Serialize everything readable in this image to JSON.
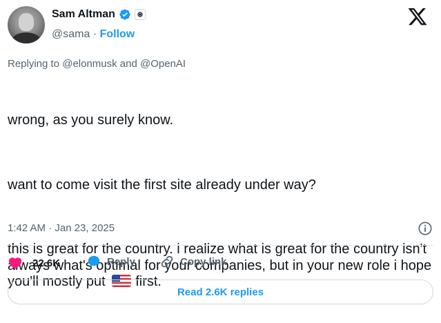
{
  "author": {
    "name": "Sam Altman",
    "handle": "@sama",
    "separator": " · ",
    "follow_label": "Follow",
    "verified_color": "#1d9bf0"
  },
  "reply_context": "Replying to @elonmusk and @OpenAI",
  "tweet": {
    "paragraph_1": "wrong, as you surely know.",
    "paragraph_2": "want to come visit the first site already under way?",
    "paragraph_3_before_flag": "this is great for the country. i realize what is great for the country isn't always what's optimal for your companies, but in your new role i hope you'll mostly put",
    "paragraph_3_after_flag": "first."
  },
  "timestamp": "1:42 AM · Jan 23, 2025",
  "actions": {
    "likes": "22.6K",
    "reply_label": "Reply",
    "copy_link_label": "Copy link"
  },
  "read_replies_label": "Read 2.6K replies",
  "colors": {
    "accent": "#1d9bf0",
    "like": "#f91880",
    "muted": "#536471",
    "text": "#0f1419"
  },
  "icons": [
    "verified-badge-icon",
    "openai-badge-icon",
    "x-logo-icon",
    "info-icon",
    "heart-icon",
    "reply-bubble-icon",
    "link-icon",
    "us-flag-emoji"
  ]
}
